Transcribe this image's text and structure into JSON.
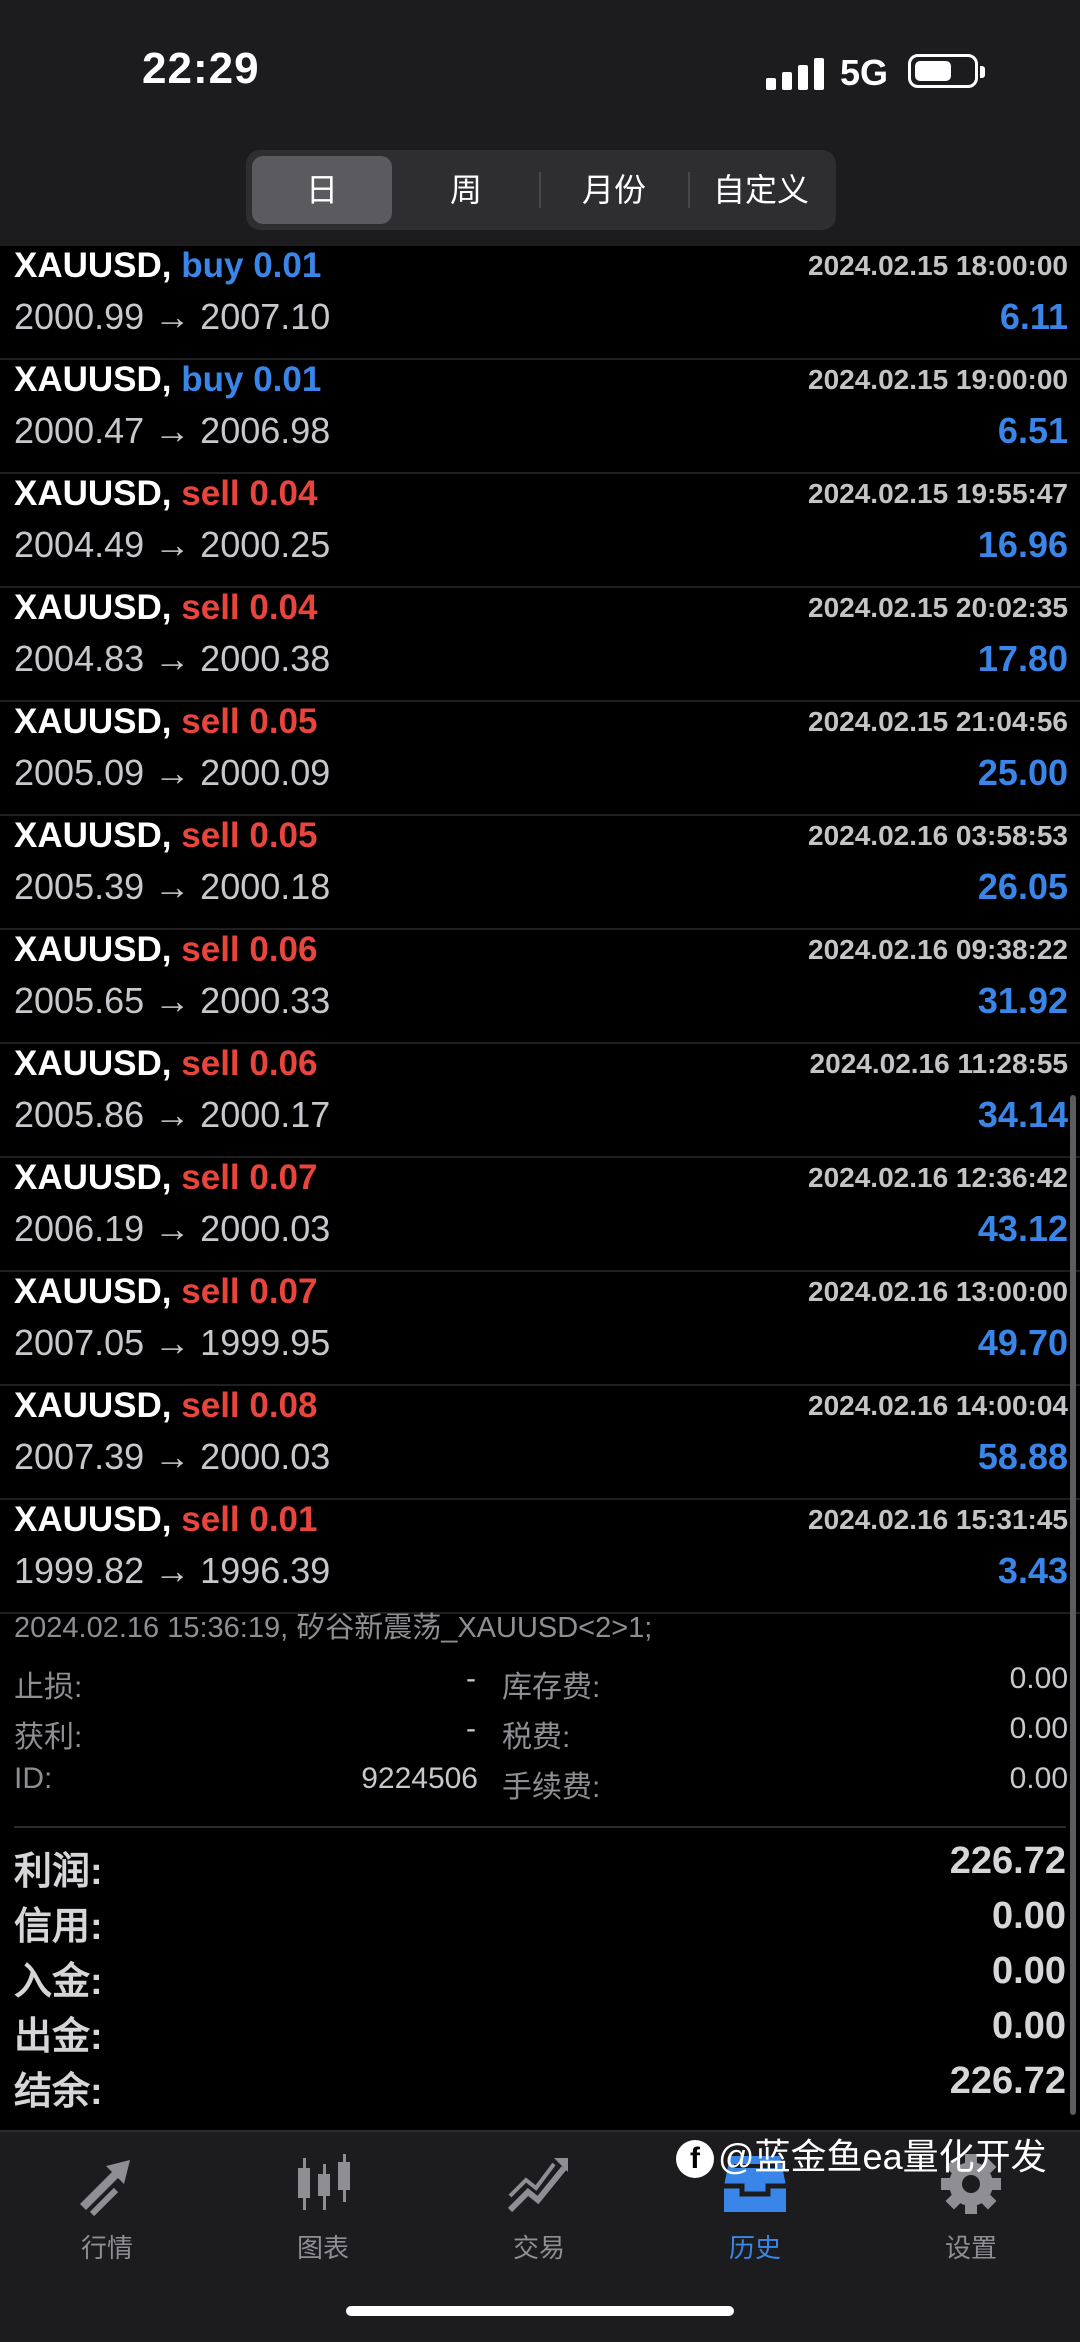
{
  "status_bar": {
    "time": "22:29",
    "network": "5G"
  },
  "period_tabs": [
    "日",
    "周",
    "月份",
    "自定义"
  ],
  "active_period": "日",
  "trades": [
    {
      "symbol": "XAUUSD,",
      "side": "buy",
      "lot": "buy 0.01",
      "time": "2024.02.15 18:00:00",
      "open": "2000.99",
      "close": "2007.10",
      "arrow": "→",
      "profit": "6.11"
    },
    {
      "symbol": "XAUUSD,",
      "side": "buy",
      "lot": "buy 0.01",
      "time": "2024.02.15 19:00:00",
      "open": "2000.47",
      "close": "2006.98",
      "arrow": "→",
      "profit": "6.51"
    },
    {
      "symbol": "XAUUSD,",
      "side": "sell",
      "lot": "sell 0.04",
      "time": "2024.02.15 19:55:47",
      "open": "2004.49",
      "close": "2000.25",
      "arrow": "→",
      "profit": "16.96"
    },
    {
      "symbol": "XAUUSD,",
      "side": "sell",
      "lot": "sell 0.04",
      "time": "2024.02.15 20:02:35",
      "open": "2004.83",
      "close": "2000.38",
      "arrow": "→",
      "profit": "17.80"
    },
    {
      "symbol": "XAUUSD,",
      "side": "sell",
      "lot": "sell 0.05",
      "time": "2024.02.15 21:04:56",
      "open": "2005.09",
      "close": "2000.09",
      "arrow": "→",
      "profit": "25.00"
    },
    {
      "symbol": "XAUUSD,",
      "side": "sell",
      "lot": "sell 0.05",
      "time": "2024.02.16 03:58:53",
      "open": "2005.39",
      "close": "2000.18",
      "arrow": "→",
      "profit": "26.05"
    },
    {
      "symbol": "XAUUSD,",
      "side": "sell",
      "lot": "sell 0.06",
      "time": "2024.02.16 09:38:22",
      "open": "2005.65",
      "close": "2000.33",
      "arrow": "→",
      "profit": "31.92"
    },
    {
      "symbol": "XAUUSD,",
      "side": "sell",
      "lot": "sell 0.06",
      "time": "2024.02.16 11:28:55",
      "open": "2005.86",
      "close": "2000.17",
      "arrow": "→",
      "profit": "34.14"
    },
    {
      "symbol": "XAUUSD,",
      "side": "sell",
      "lot": "sell 0.07",
      "time": "2024.02.16 12:36:42",
      "open": "2006.19",
      "close": "2000.03",
      "arrow": "→",
      "profit": "43.12"
    },
    {
      "symbol": "XAUUSD,",
      "side": "sell",
      "lot": "sell 0.07",
      "time": "2024.02.16 13:00:00",
      "open": "2007.05",
      "close": "1999.95",
      "arrow": "→",
      "profit": "49.70"
    },
    {
      "symbol": "XAUUSD,",
      "side": "sell",
      "lot": "sell 0.08",
      "time": "2024.02.16 14:00:04",
      "open": "2007.39",
      "close": "2000.03",
      "arrow": "→",
      "profit": "58.88"
    },
    {
      "symbol": "XAUUSD,",
      "side": "sell",
      "lot": "sell 0.01",
      "time": "2024.02.16 15:31:45",
      "open": "1999.82",
      "close": "1996.39",
      "arrow": "→",
      "profit": "3.43"
    }
  ],
  "detail": {
    "comment": "2024.02.16 15:36:19, 矽谷新震荡_XAUUSD<2>1;",
    "stop_loss_label": "止损:",
    "stop_loss": "-",
    "take_profit_label": "获利:",
    "take_profit": "-",
    "id_label": "ID:",
    "id": "9224506",
    "swap_label": "库存费:",
    "swap": "0.00",
    "tax_label": "税费:",
    "tax": "0.00",
    "commission_label": "手续费:",
    "commission": "0.00"
  },
  "summary": [
    {
      "label": "利润:",
      "value": "226.72"
    },
    {
      "label": "信用:",
      "value": "0.00"
    },
    {
      "label": "入金:",
      "value": "0.00"
    },
    {
      "label": "出金:",
      "value": "0.00"
    },
    {
      "label": "结余:",
      "value": "226.72"
    }
  ],
  "tabs": [
    {
      "label": "行情",
      "icon": "quotes-arrows-icon"
    },
    {
      "label": "图表",
      "icon": "candlestick-chart-icon"
    },
    {
      "label": "交易",
      "icon": "trade-chart-icon"
    },
    {
      "label": "历史",
      "icon": "history-inbox-icon"
    },
    {
      "label": "设置",
      "icon": "gear-icon"
    }
  ],
  "active_tab": "历史",
  "watermark": "@蓝金鱼ea量化开发",
  "colors": {
    "buy": "#3a86e8",
    "sell": "#e8453d",
    "profit": "#3a86e8",
    "active_tab": "#3a86e8"
  }
}
